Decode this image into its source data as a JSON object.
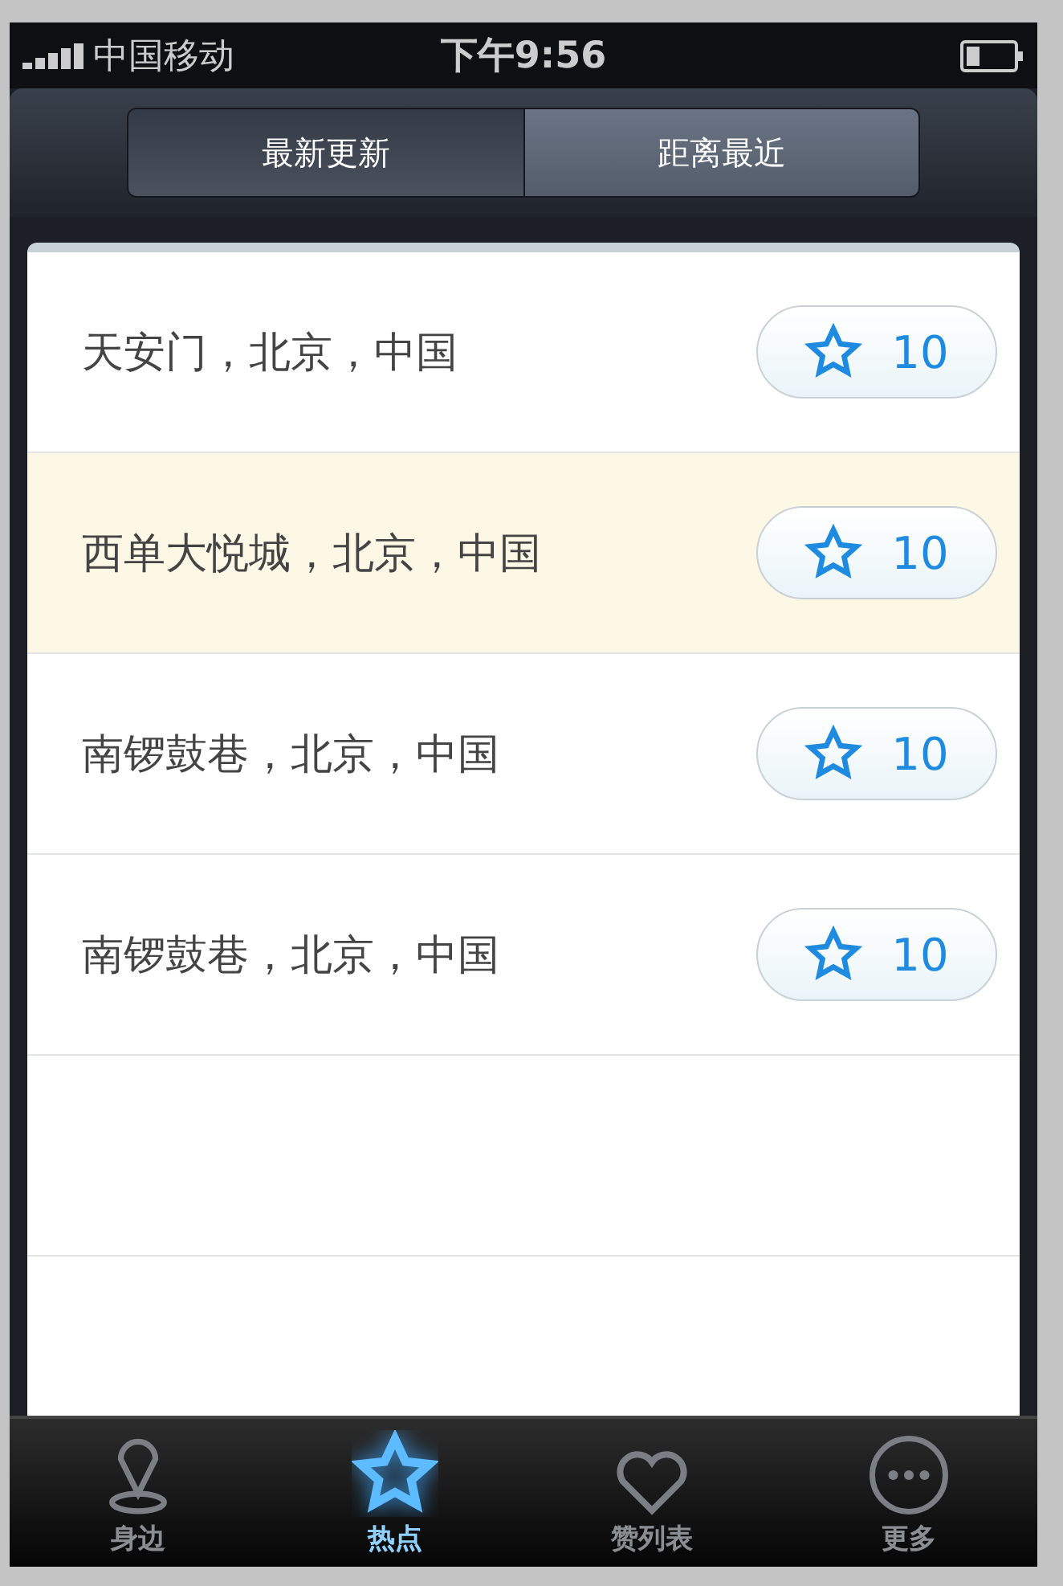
{
  "status_bar": {
    "carrier": "中国移动",
    "time": "下午9:56"
  },
  "segments": [
    {
      "label": "最新更新",
      "selected": false
    },
    {
      "label": "距离最近",
      "selected": true
    }
  ],
  "places": [
    {
      "name": "天安门，北京，中国",
      "likes": "10",
      "selected": false
    },
    {
      "name": "西单大悦城，北京，中国",
      "likes": "10",
      "selected": true
    },
    {
      "name": "南锣鼓巷，北京，中国",
      "likes": "10",
      "selected": false
    },
    {
      "name": "南锣鼓巷，北京，中国",
      "likes": "10",
      "selected": false
    }
  ],
  "tab_bar": [
    {
      "label": "身边",
      "kind": "pin",
      "selected": false
    },
    {
      "label": "热点",
      "kind": "star",
      "selected": true
    },
    {
      "label": "赞列表",
      "kind": "heart",
      "selected": false
    },
    {
      "label": "更多",
      "kind": "more",
      "selected": false
    }
  ]
}
